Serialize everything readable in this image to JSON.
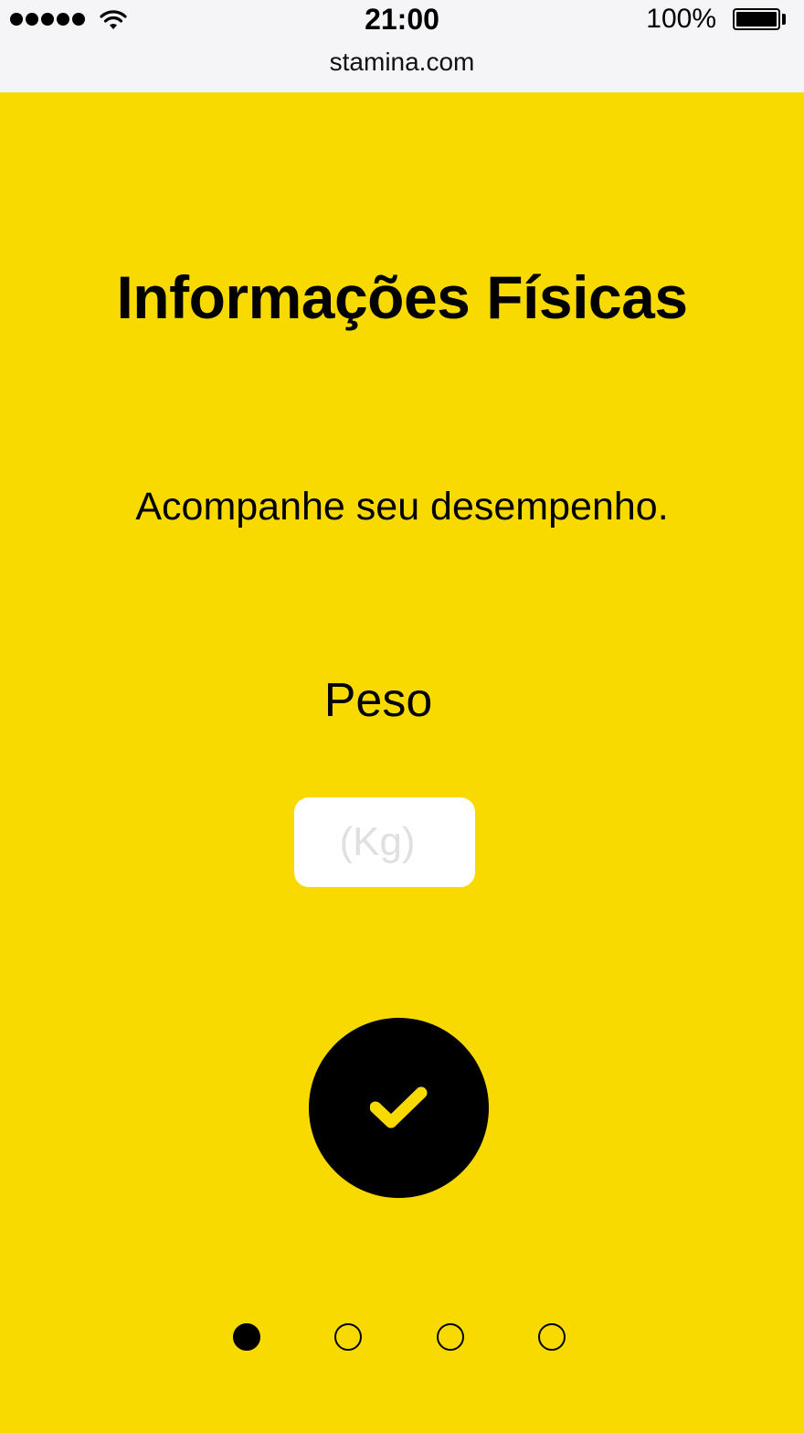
{
  "status_bar": {
    "time": "21:00",
    "battery_percent": "100%",
    "battery_level": 1.0,
    "signal_bars": 5,
    "url": "stamina.com"
  },
  "page": {
    "title": "Informações Físicas",
    "subtitle": "Acompanhe seu desempenho.",
    "field_label": "Peso",
    "input_placeholder": "(Kg)",
    "input_value": ""
  },
  "confirm_button": {
    "icon": "checkmark-icon"
  },
  "pagination": {
    "total": 4,
    "active_index": 0
  },
  "colors": {
    "background": "#f8da00",
    "accent": "#f8da00",
    "button": "#000000",
    "status_bar": "#f5f5f7"
  }
}
